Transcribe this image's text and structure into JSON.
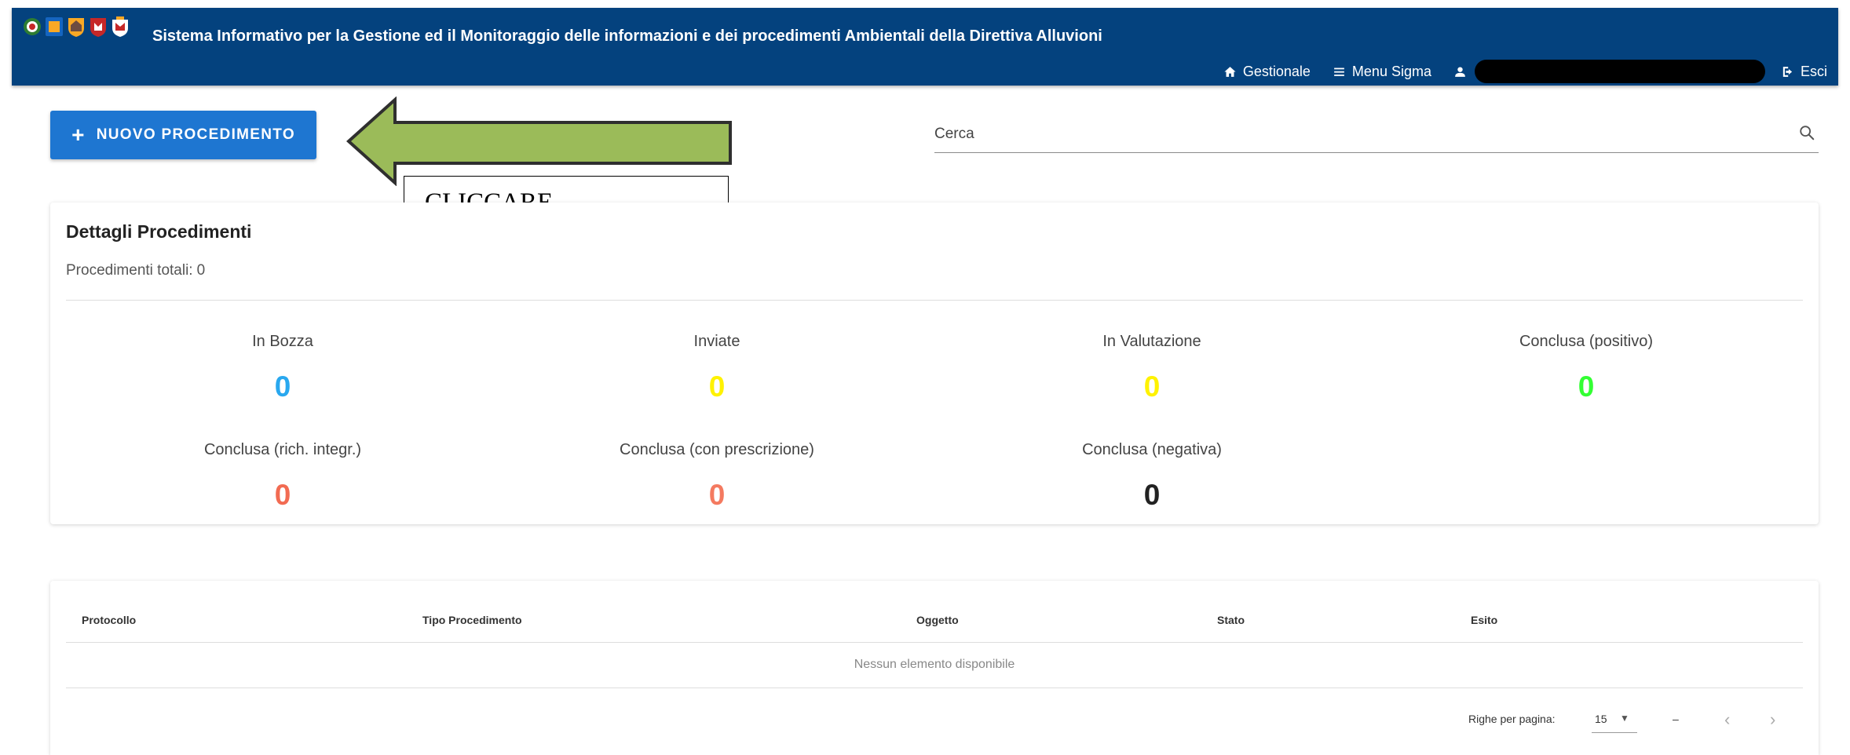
{
  "header": {
    "title": "Sistema Informativo per la Gestione ed il Monitoraggio delle informazioni e dei procedimenti Ambientali della Direttiva Alluvioni",
    "nav": {
      "gestionale": "Gestionale",
      "menu_sigma": "Menu Sigma",
      "esci": "Esci"
    },
    "logo_icons": [
      "coat-of-arms-1",
      "coat-of-arms-2",
      "coat-of-arms-3",
      "coat-of-arms-4",
      "coat-of-arms-5"
    ]
  },
  "toolbar": {
    "new_button_label": "NUOVO PROCEDIMENTO",
    "search_placeholder": "Cerca"
  },
  "annotation": {
    "text": "CLICCARE",
    "arrow_color": "#9bbb59"
  },
  "summary": {
    "title": "Dettagli Procedimenti",
    "total_label": "Procedimenti totali:",
    "total_value": "0",
    "stats": [
      {
        "label": "In Bozza",
        "value": "0",
        "color": "#29a8ef"
      },
      {
        "label": "Inviate",
        "value": "0",
        "color": "#fff200"
      },
      {
        "label": "In Valutazione",
        "value": "0",
        "color": "#fff200"
      },
      {
        "label": "Conclusa (positivo)",
        "value": "0",
        "color": "#33ff33"
      },
      {
        "label": "Conclusa (rich. integr.)",
        "value": "0",
        "color": "#f26b52"
      },
      {
        "label": "Conclusa (con prescrizione)",
        "value": "0",
        "color": "#f47a60"
      },
      {
        "label": "Conclusa (negativa)",
        "value": "0",
        "color": "#222222"
      }
    ]
  },
  "table": {
    "columns": [
      "Protocollo",
      "Tipo Procedimento",
      "Oggetto",
      "Stato",
      "Esito"
    ],
    "empty_message": "Nessun elemento disponibile",
    "rows_per_page_label": "Righe per pagina:",
    "rows_per_page_value": "15",
    "range_text": "–"
  },
  "colors": {
    "header_bg": "#04427e",
    "primary_button": "#1e76d1"
  }
}
